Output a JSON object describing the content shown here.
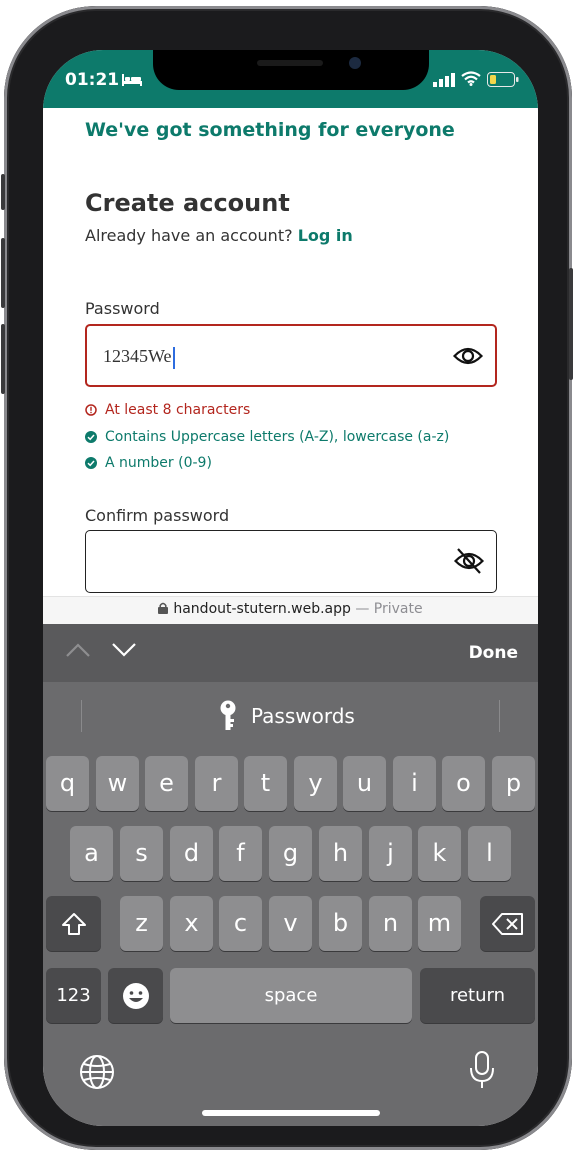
{
  "status_bar": {
    "time": "01:21",
    "icons": [
      "bed-icon",
      "signal-icon",
      "wifi-icon",
      "battery-icon"
    ]
  },
  "page": {
    "tagline": "We've got something for everyone",
    "heading": "Create account",
    "subline_text": "Already have an account?",
    "login_link": "Log in",
    "password_label": "Password",
    "password_value": "12345We",
    "confirm_label": "Confirm password",
    "confirm_value": "",
    "rules": [
      {
        "text": "At least 8 characters",
        "status": "fail"
      },
      {
        "text": "Contains Uppercase letters (A-Z), lowercase (a-z)",
        "status": "pass"
      },
      {
        "text": "A number (0-9)",
        "status": "pass"
      }
    ]
  },
  "url_bar": {
    "domain": "handout-stutern.web.app",
    "suffix": "— Private"
  },
  "keyboard": {
    "done_label": "Done",
    "suggestion": "Passwords",
    "rows": [
      [
        "q",
        "w",
        "e",
        "r",
        "t",
        "y",
        "u",
        "i",
        "o",
        "p"
      ],
      [
        "a",
        "s",
        "d",
        "f",
        "g",
        "h",
        "j",
        "k",
        "l"
      ],
      [
        "z",
        "x",
        "c",
        "v",
        "b",
        "n",
        "m"
      ]
    ],
    "numbers_key": "123",
    "space_key": "space",
    "return_key": "return"
  },
  "colors": {
    "brand": "#0d7a6b",
    "error": "#b3261e"
  }
}
